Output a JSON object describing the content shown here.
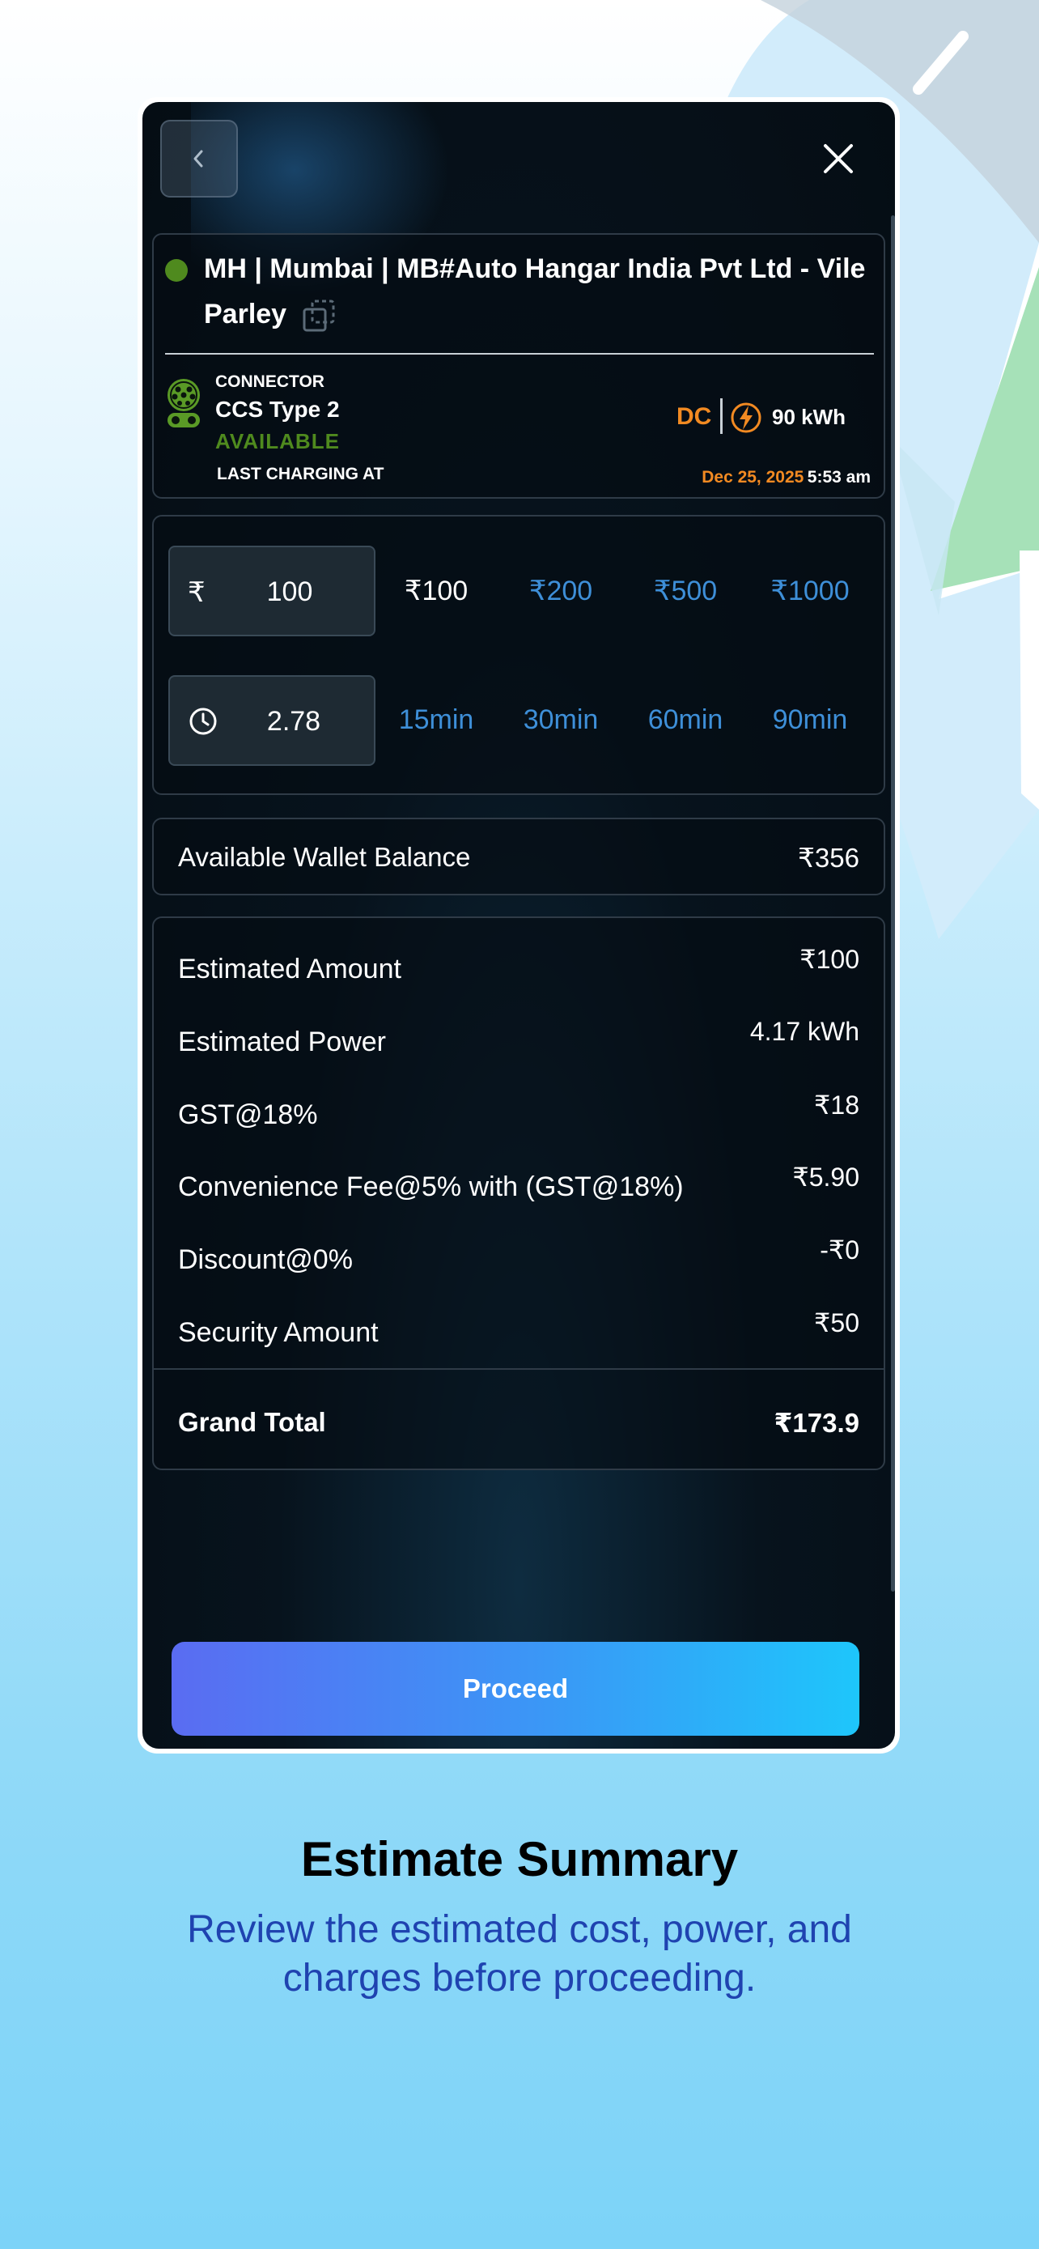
{
  "station": {
    "name": "MH | Mumbai | MB#Auto Hangar India Pvt Ltd - Vile Parley",
    "connector_label": "CONNECTOR",
    "connector_type": "CCS Type 2",
    "status": "AVAILABLE",
    "last_charging_label": "LAST CHARGING AT",
    "current_type": "DC",
    "power": "90 kWh",
    "last_charging_date": "Dec 25, 2025",
    "last_charging_time": "5:53 am"
  },
  "amount": {
    "currency_symbol": "₹",
    "value": "100",
    "chips": [
      "₹100",
      "₹200",
      "₹500",
      "₹1000"
    ]
  },
  "duration": {
    "value": "2.78",
    "chips": [
      "15min",
      "30min",
      "60min",
      "90min"
    ]
  },
  "wallet": {
    "label": "Available Wallet Balance",
    "value": "₹356"
  },
  "estimate": {
    "rows": [
      {
        "label": "Estimated Amount",
        "value": "₹100"
      },
      {
        "label": "Estimated Power",
        "value": "4.17 kWh"
      },
      {
        "label": "GST@18%",
        "value": "₹18"
      },
      {
        "label": "Convenience Fee@5% with (GST@18%)",
        "value": "₹5.90"
      },
      {
        "label": "Discount@0%",
        "value": "-₹0"
      },
      {
        "label": "Security Amount",
        "value": "₹50"
      }
    ],
    "grand_total_label": "Grand Total",
    "grand_total_value": "₹173.9"
  },
  "proceed_label": "Proceed",
  "caption": {
    "title": "Estimate Summary",
    "subtitle": "Review the estimated cost, power, and charges before proceeding."
  },
  "colors": {
    "accent_blue": "#3e8fd8",
    "available_green": "#4f8a1e",
    "dc_orange": "#f28a22",
    "caption_blue": "#1f43b0"
  }
}
